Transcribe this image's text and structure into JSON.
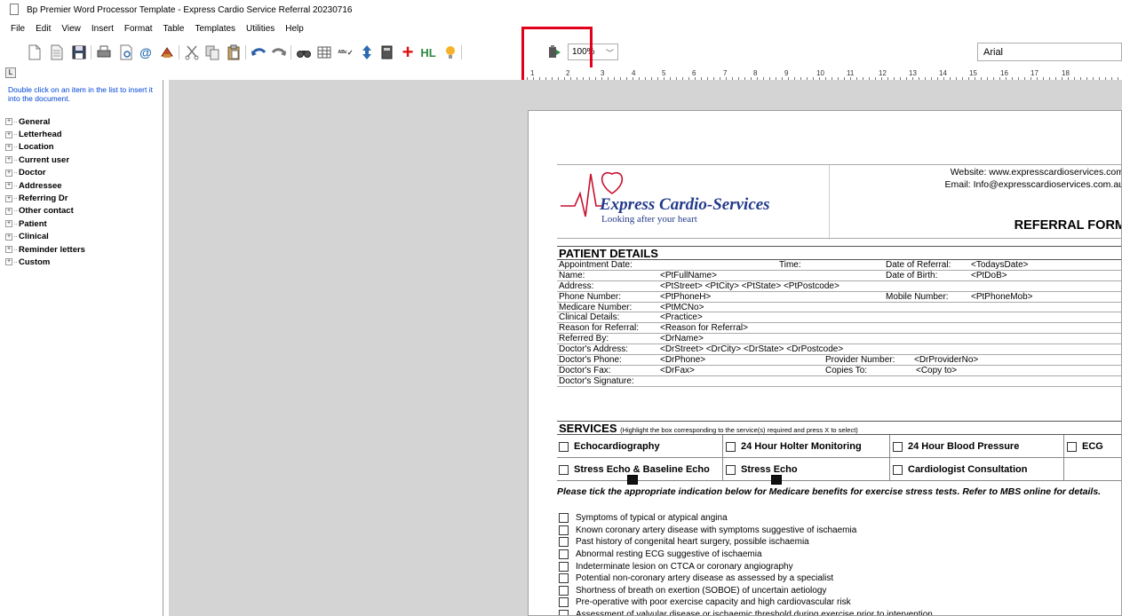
{
  "window": {
    "title": "Bp Premier Word Processor Template - Express Cardio Service Referral 20230716"
  },
  "menu": [
    "File",
    "Edit",
    "View",
    "Insert",
    "Format",
    "Table",
    "Templates",
    "Utilities",
    "Help"
  ],
  "toolbar": {
    "zoom": "100%",
    "font": "Arial",
    "icons": [
      "new-document-icon",
      "open-document-icon",
      "save-icon",
      "print-icon",
      "print-preview-icon",
      "email-icon",
      "spell-icon",
      "cut-icon",
      "copy-icon",
      "paste-icon",
      "undo-icon",
      "redo-icon",
      "find-icon",
      "table-icon",
      "spellcheck-icon",
      "sort-icon",
      "insert-field-icon",
      "add-icon",
      "hl-icon",
      "lightbulb-icon",
      "form-field-icon"
    ]
  },
  "ruler": {
    "numbers": [
      "1",
      "2",
      "3",
      "4",
      "5",
      "6",
      "7",
      "8",
      "9",
      "10",
      "11",
      "12",
      "13",
      "14",
      "15",
      "16",
      "17",
      "18"
    ]
  },
  "left_panel": {
    "hint": "Double click on an item in the list to insert it into the document.",
    "tree": [
      "General",
      "Letterhead",
      "Location",
      "Current user",
      "Doctor",
      "Addressee",
      "Referring Dr",
      "Other contact",
      "Patient",
      "Clinical",
      "Reminder letters",
      "Custom"
    ]
  },
  "letterhead": {
    "logo_name": "Express Cardio-Services",
    "logo_tagline": "Looking after your heart",
    "website": "Website: www.expresscardioservices.com",
    "email": "Email: Info@expresscardioservices.com.au",
    "form_title": "REFERRAL FORM"
  },
  "patient_details": {
    "heading": "PATIENT DETAILS",
    "rows": [
      {
        "label": "Appointment Date:",
        "v1": "",
        "l2": "Time:",
        "v2": "",
        "l3": "Date of Referral:",
        "v3": "<TodaysDate>"
      },
      {
        "label": "Name:",
        "v1": "<PtFullName>",
        "l2": "",
        "v2": "",
        "l3": "Date of Birth:",
        "v3": "<PtDoB>"
      },
      {
        "label": "Address:",
        "v1": "<PtStreet>  <PtCity>  <PtState>  <PtPostcode>",
        "l2": "",
        "v2": "",
        "l3": "",
        "v3": ""
      },
      {
        "label": "Phone Number:",
        "v1": "<PtPhoneH>",
        "l2": "",
        "v2": "",
        "l3": "Mobile Number:",
        "v3": "<PtPhoneMob>"
      },
      {
        "label": "Medicare Number:",
        "v1": "<PtMCNo>",
        "l2": "",
        "v2": "",
        "l3": "",
        "v3": ""
      },
      {
        "label": "Clinical Details:",
        "v1": "<Practice>",
        "l2": "",
        "v2": "",
        "l3": "",
        "v3": ""
      },
      {
        "label": "Reason for Referral:",
        "v1": "<Reason for Referral>",
        "l2": "",
        "v2": "",
        "l3": "",
        "v3": ""
      },
      {
        "label": "Referred By:",
        "v1": "<DrName>",
        "l2": "",
        "v2": "",
        "l3": "",
        "v3": ""
      },
      {
        "label": "Doctor's Address:",
        "v1": "<DrStreet>  <DrCity>  <DrState>  <DrPostcode>",
        "l2": "",
        "v2": "",
        "l3": "",
        "v3": ""
      },
      {
        "label": "Doctor's Phone:",
        "v1": "<DrPhone>",
        "l2": "Provider Number:",
        "v2": "<DrProviderNo>",
        "l3": "",
        "v3": ""
      },
      {
        "label": "Doctor's Fax:",
        "v1": "<DrFax>",
        "l2": "Copies To:",
        "v2": "<Copy to>",
        "l3": "",
        "v3": ""
      },
      {
        "label": "Doctor's Signature:",
        "v1": "",
        "l2": "",
        "v2": "",
        "l3": "",
        "v3": ""
      }
    ]
  },
  "services": {
    "heading": "SERVICES",
    "heading_note": "(Highlight the box corresponding to the service(s) required and press X to select)",
    "row1": [
      "Echocardiography",
      "24 Hour Holter Monitoring",
      "24 Hour Blood Pressure",
      "ECG"
    ],
    "row2": [
      "Stress Echo & Baseline Echo",
      "Stress Echo",
      "Cardiologist Consultation"
    ]
  },
  "mbs_note": "Please tick the appropriate indication below for Medicare benefits for exercise stress tests. Refer to MBS online for details.",
  "indications": [
    "Symptoms of typical or atypical angina",
    "Known coronary artery disease with symptoms suggestive of ischaemia",
    "Past history of congenital heart surgery, possible ischaemia",
    "Abnormal resting ECG suggestive of ischaemia",
    "Indeterminate lesion on CTCA or coronary angiography",
    "Potential non-coronary artery disease as assessed by a specialist",
    "Shortness of breath on exertion (SOBOE) of uncertain aetiology",
    "Pre-operative with poor exercise capacity and high cardiovascular risk",
    "Assessment of valvular disease or ischaemic threshold during exercise prior to intervention"
  ]
}
